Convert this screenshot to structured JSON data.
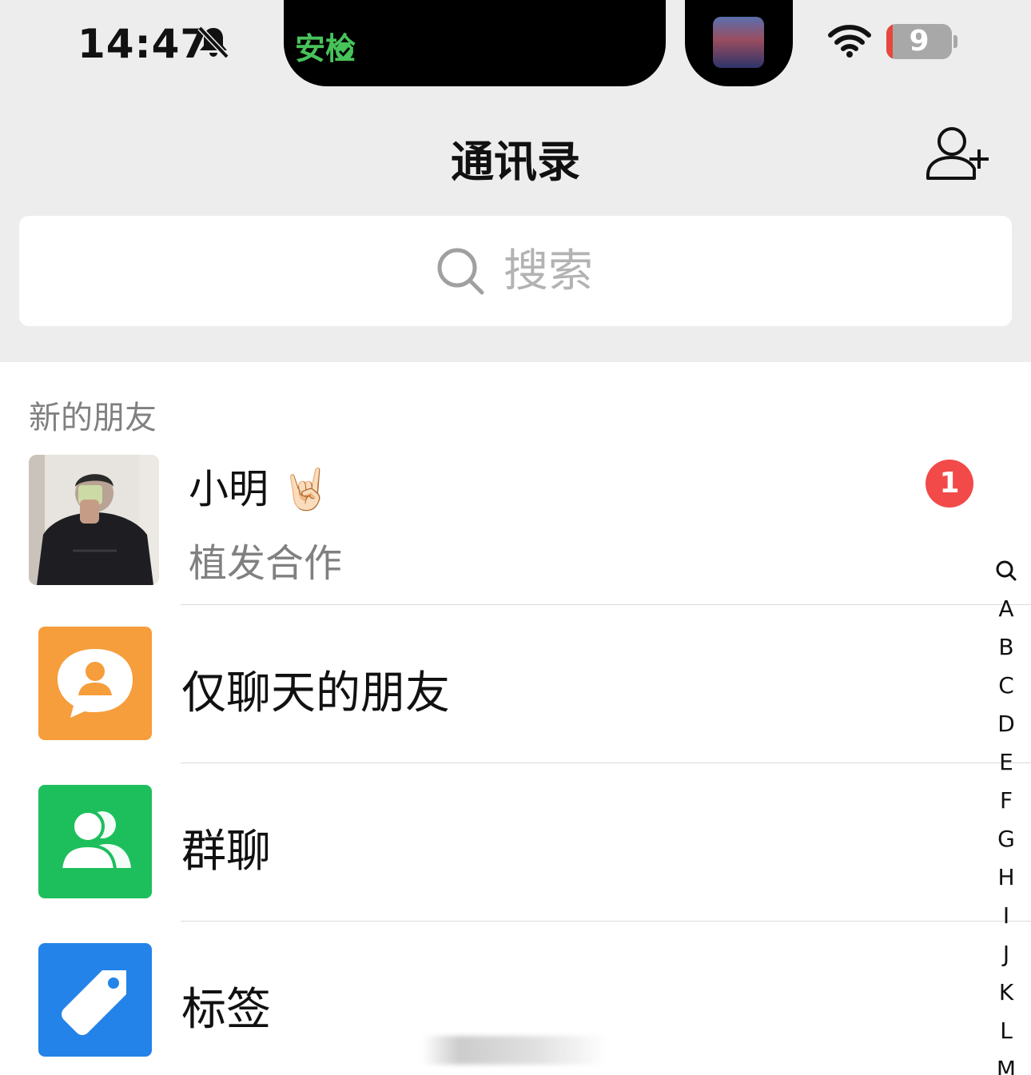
{
  "status_bar": {
    "time": "14:47",
    "island_app": "安检",
    "battery": "9",
    "icons": [
      "bell-off-icon",
      "wifi-icon",
      "battery-icon"
    ]
  },
  "nav": {
    "title": "通讯录",
    "add_icon": "add-contact-icon"
  },
  "search": {
    "placeholder": "搜索",
    "icon": "search-icon"
  },
  "new_friends": {
    "header": "新的朋友",
    "request": {
      "name": "小明",
      "emoji": "🤘🏻",
      "message": "植发合作",
      "badge": "1"
    }
  },
  "entries": [
    {
      "label": "仅聊天的朋友",
      "icon": "chat-only-icon",
      "color": "#f69d3c"
    },
    {
      "label": "群聊",
      "icon": "group-chat-icon",
      "color": "#1dbf5c"
    },
    {
      "label": "标签",
      "icon": "tag-icon",
      "color": "#2383e8"
    }
  ],
  "index_bar": [
    "A",
    "B",
    "C",
    "D",
    "E",
    "F",
    "G",
    "H",
    "I",
    "J",
    "K",
    "L",
    "M"
  ]
}
